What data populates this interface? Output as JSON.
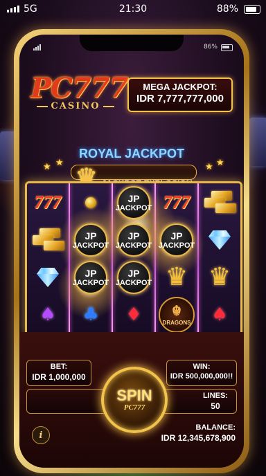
{
  "device_status": {
    "network": "5G",
    "time": "21:30",
    "battery": "88%"
  },
  "game_status": {
    "battery": "86%"
  },
  "logo": {
    "brand": "PC777",
    "sub": "CASINO"
  },
  "mega_jackpot": {
    "label": "MEGA JACKPOT:",
    "value": "IDR 7,777,777,000"
  },
  "banner": {
    "title": "ROYAL JACKPOT",
    "subtitle": "JACKPOT EXPLOSION"
  },
  "reels": {
    "jp_line1": "JP",
    "jp_line2": "JACKPOT",
    "seven": "777",
    "dragon_label": "DRAGONS"
  },
  "controls": {
    "bet_label": "BET:",
    "bet_value": "IDR 1,000,000",
    "win_label": "WIN:",
    "win_value": "IDR 500,000,000!!",
    "lines_label": "LINES:",
    "lines_value": "50",
    "spin_label": "SPIN",
    "spin_sub": "PC777",
    "info_label": "i",
    "balance_label": "BALANCE:",
    "balance_value": "IDR 12,345,678,900"
  },
  "colors": {
    "gold": "#f1c34c",
    "neon_pink": "#ff6cf0",
    "royal_blue": "#8fd6ff",
    "seven_red": "#ff3b2b"
  }
}
